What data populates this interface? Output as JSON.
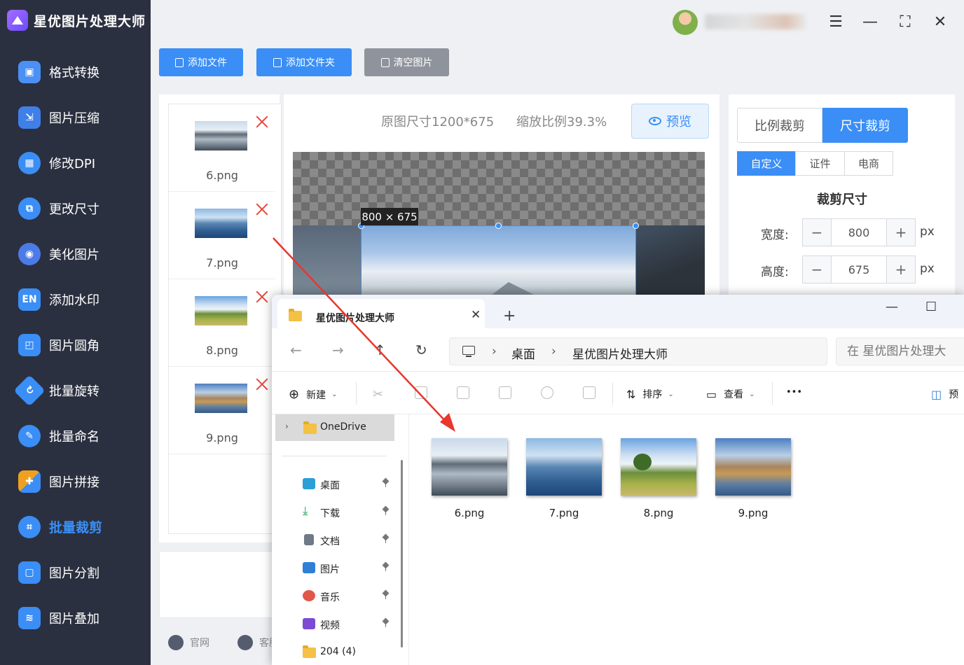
{
  "app": {
    "title": "星优图片处理大师"
  },
  "sidebar": {
    "items": [
      {
        "label": "格式转换",
        "icon": "image-convert-icon",
        "color": "#4a90f5"
      },
      {
        "label": "图片压缩",
        "icon": "image-compress-icon",
        "color": "#3f7fe8"
      },
      {
        "label": "修改DPI",
        "icon": "dpi-icon",
        "color": "#3a8ef6"
      },
      {
        "label": "更改尺寸",
        "icon": "resize-icon",
        "color": "#3a8ef6"
      },
      {
        "label": "美化图片",
        "icon": "beautify-icon",
        "color": "#4b7be8"
      },
      {
        "label": "添加水印",
        "icon": "watermark-icon",
        "color": "#3a8ef6"
      },
      {
        "label": "图片圆角",
        "icon": "round-corner-icon",
        "color": "#3a8ef6"
      },
      {
        "label": "批量旋转",
        "icon": "rotate-icon",
        "color": "#3a8ef6"
      },
      {
        "label": "批量命名",
        "icon": "rename-icon",
        "color": "#3a8ef6"
      },
      {
        "label": "图片拼接",
        "icon": "puzzle-icon",
        "color": "#f0a020"
      },
      {
        "label": "批量裁剪",
        "icon": "crop-icon",
        "color": "#3a8ef6"
      },
      {
        "label": "图片分割",
        "icon": "split-icon",
        "color": "#3a8ef6"
      },
      {
        "label": "图片叠加",
        "icon": "layers-icon",
        "color": "#3a8ef6"
      }
    ],
    "active_index": 10
  },
  "toolbar": {
    "add_file": "添加文件",
    "add_folder": "添加文件夹",
    "clear": "清空图片"
  },
  "files": [
    {
      "name": "6.png"
    },
    {
      "name": "7.png"
    },
    {
      "name": "8.png"
    },
    {
      "name": "9.png"
    }
  ],
  "footer": {
    "website": "官网",
    "service": "客服"
  },
  "preview": {
    "original_size": "原图尺寸1200*675",
    "zoom": "缩放比例39.3%",
    "preview_button": "预览",
    "dimension_label": "800 × 675"
  },
  "settings": {
    "mode_ratio": "比例裁剪",
    "mode_size": "尺寸裁剪",
    "sub_custom": "自定义",
    "sub_id": "证件",
    "sub_ecom": "电商",
    "crop_size_title": "裁剪尺寸",
    "width_label": "宽度:",
    "height_label": "高度:",
    "width_value": "800",
    "height_value": "675",
    "unit": "px",
    "minus": "−",
    "plus": "+"
  },
  "explorer": {
    "tab_title": "星优图片处理大师",
    "breadcrumb": [
      "桌面",
      "星优图片处理大师"
    ],
    "search_placeholder": "在 星优图片处理大",
    "cmd": {
      "new": "新建",
      "sort": "排序",
      "view": "查看",
      "more": "•••",
      "preview": "预"
    },
    "onedrive": "OneDrive",
    "quick_access": [
      {
        "label": "桌面",
        "icon": "desktop-icon",
        "color": "#2a9fd8"
      },
      {
        "label": "下载",
        "icon": "download-icon",
        "color": "#2a9d5a"
      },
      {
        "label": "文档",
        "icon": "document-icon",
        "color": "#6f7a88"
      },
      {
        "label": "图片",
        "icon": "pictures-icon",
        "color": "#2f7fd6"
      },
      {
        "label": "音乐",
        "icon": "music-icon",
        "color": "#e0584a"
      },
      {
        "label": "视频",
        "icon": "video-icon",
        "color": "#7b4bd6"
      },
      {
        "label": "204 (4)",
        "icon": "folder-icon",
        "color": "#f4c145"
      }
    ],
    "grid_files": [
      {
        "name": "6.png"
      },
      {
        "name": "7.png"
      },
      {
        "name": "8.png"
      },
      {
        "name": "9.png"
      }
    ]
  }
}
